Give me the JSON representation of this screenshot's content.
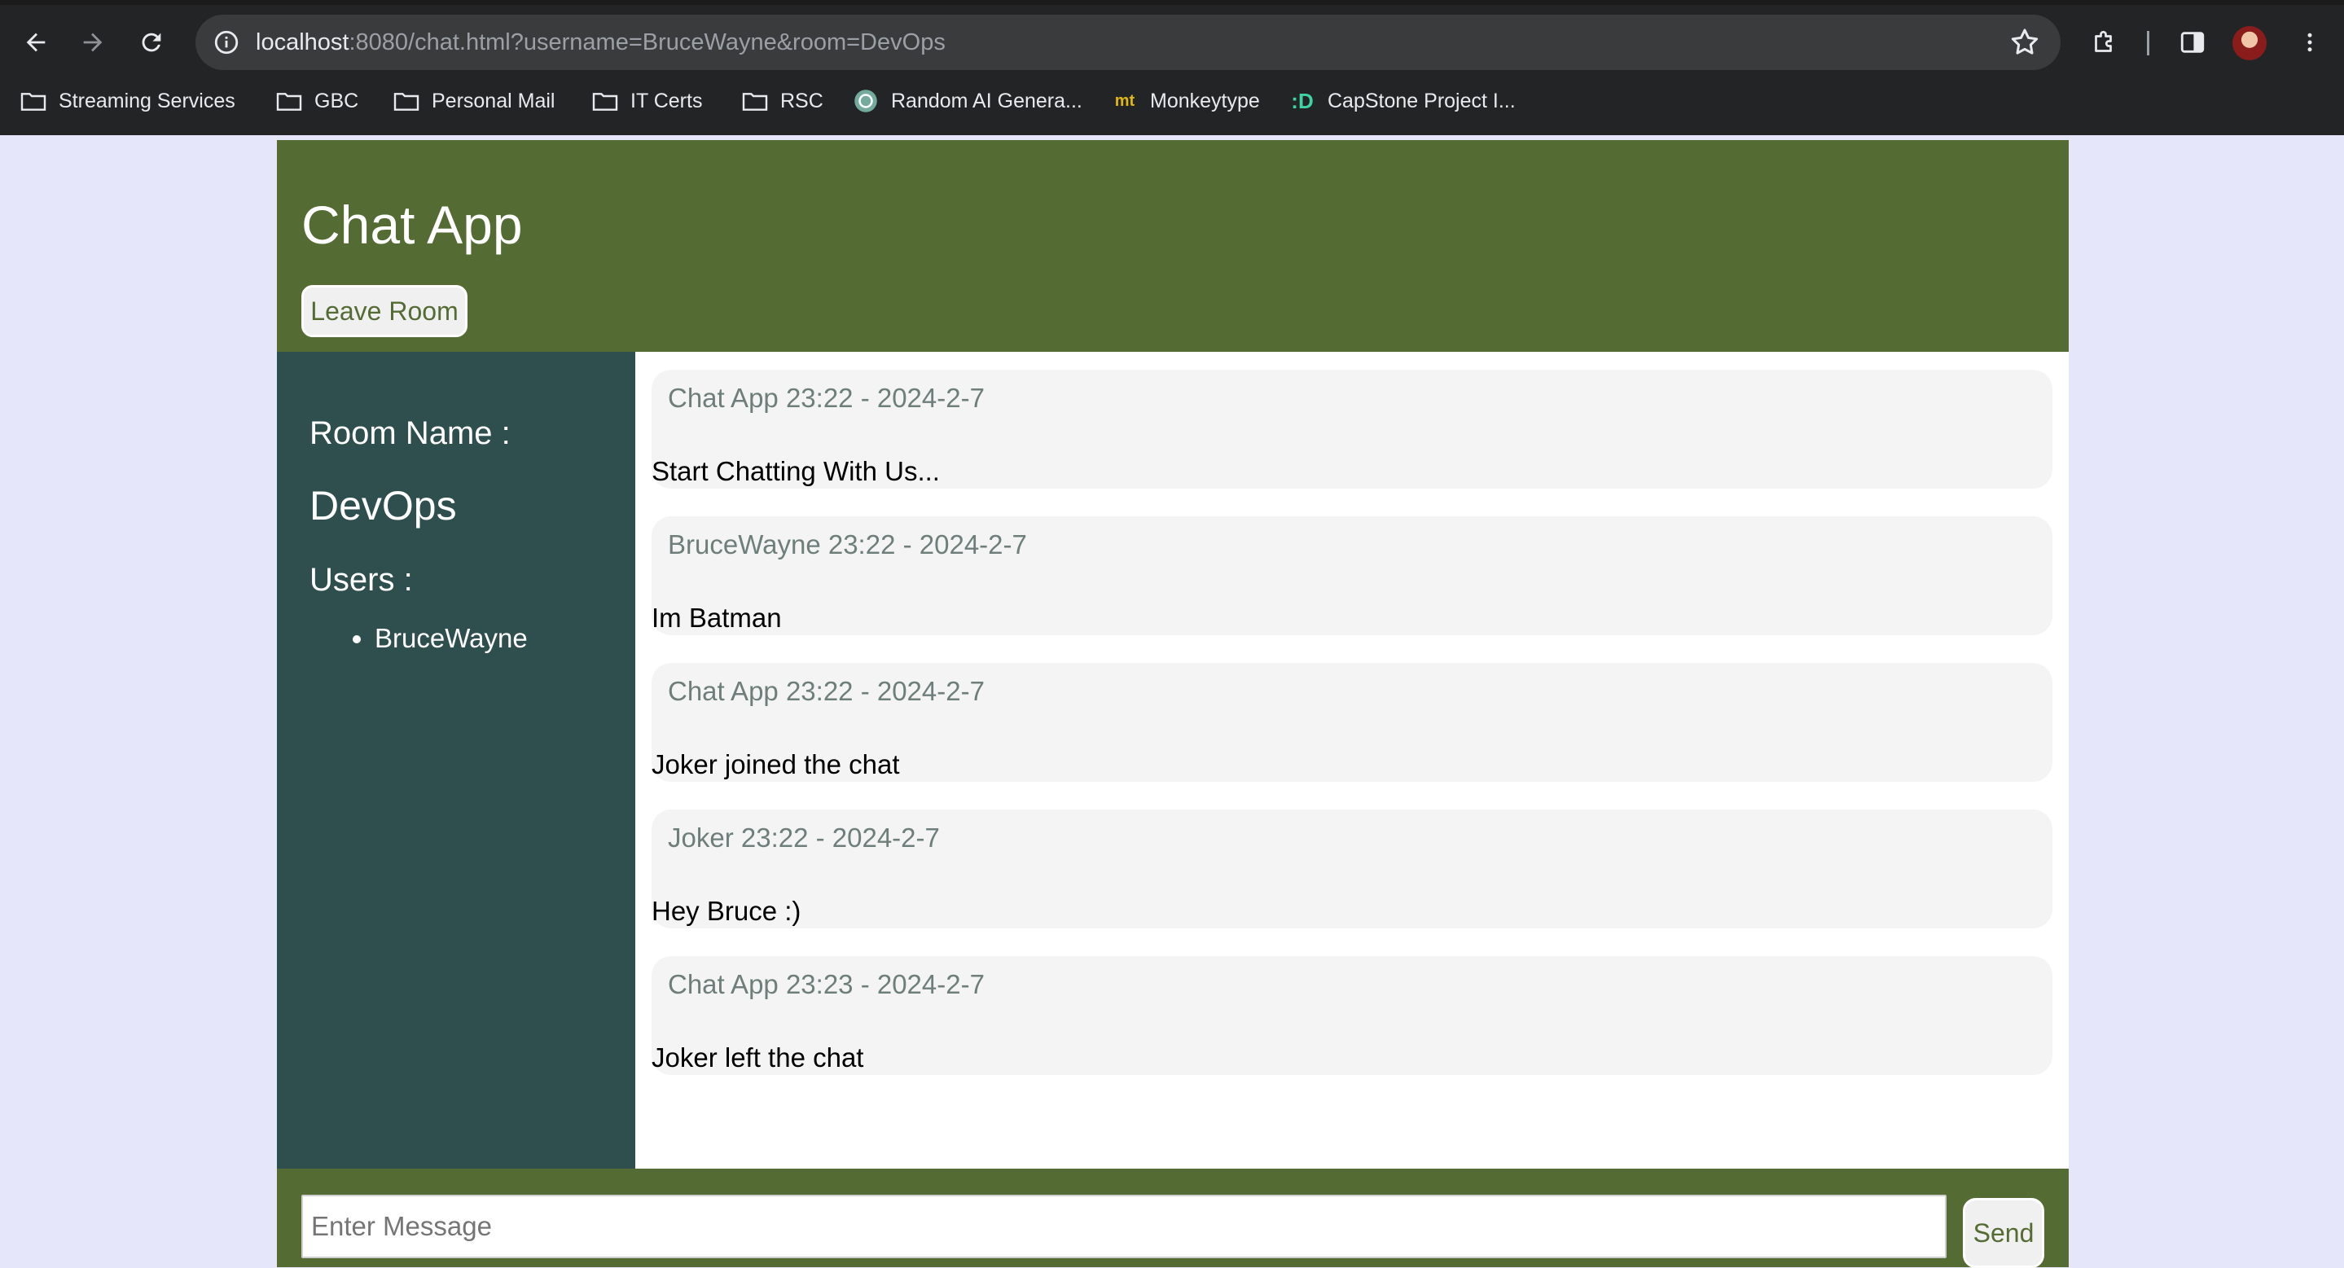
{
  "browser": {
    "url_host": "localhost",
    "url_rest": ":8080/chat.html?username=BruceWayne&room=DevOps",
    "bookmarks": [
      {
        "label": "Streaming Services",
        "icon": "folder-icon"
      },
      {
        "label": "GBC",
        "icon": "folder-icon"
      },
      {
        "label": "Personal Mail",
        "icon": "folder-icon"
      },
      {
        "label": "IT Certs",
        "icon": "folder-icon"
      },
      {
        "label": "RSC",
        "icon": "folder-icon"
      },
      {
        "label": "Random AI Genera...",
        "icon": "openai-icon"
      },
      {
        "label": "Monkeytype",
        "icon": "monkeytype-icon",
        "icon_text": "mt"
      },
      {
        "label": "CapStone Project I...",
        "icon": "capstone-icon",
        "icon_text": ":D"
      }
    ]
  },
  "app": {
    "title": "Chat App",
    "leave_label": "Leave Room",
    "sidebar": {
      "room_label": "Room Name :",
      "room_name": "DevOps",
      "users_label": "Users :",
      "users": [
        "BruceWayne"
      ]
    },
    "messages": [
      {
        "meta": "Chat App 23:22 - 2024-2-7",
        "text": "Start Chatting With Us..."
      },
      {
        "meta": "BruceWayne 23:22 - 2024-2-7",
        "text": "Im Batman"
      },
      {
        "meta": "Chat App 23:22 - 2024-2-7",
        "text": "Joker joined the chat"
      },
      {
        "meta": "Joker 23:22 - 2024-2-7",
        "text": "Hey Bruce :)"
      },
      {
        "meta": "Chat App 23:23 - 2024-2-7",
        "text": "Joker left the chat"
      }
    ],
    "compose": {
      "placeholder": "Enter Message",
      "send_label": "Send"
    }
  },
  "colors": {
    "page_bg": "#e6e6fa",
    "header_bg": "#556b34",
    "sidebar_bg": "#2f4f4f",
    "message_bg": "#f4f4f4",
    "meta_text": "#6e7f7b"
  }
}
